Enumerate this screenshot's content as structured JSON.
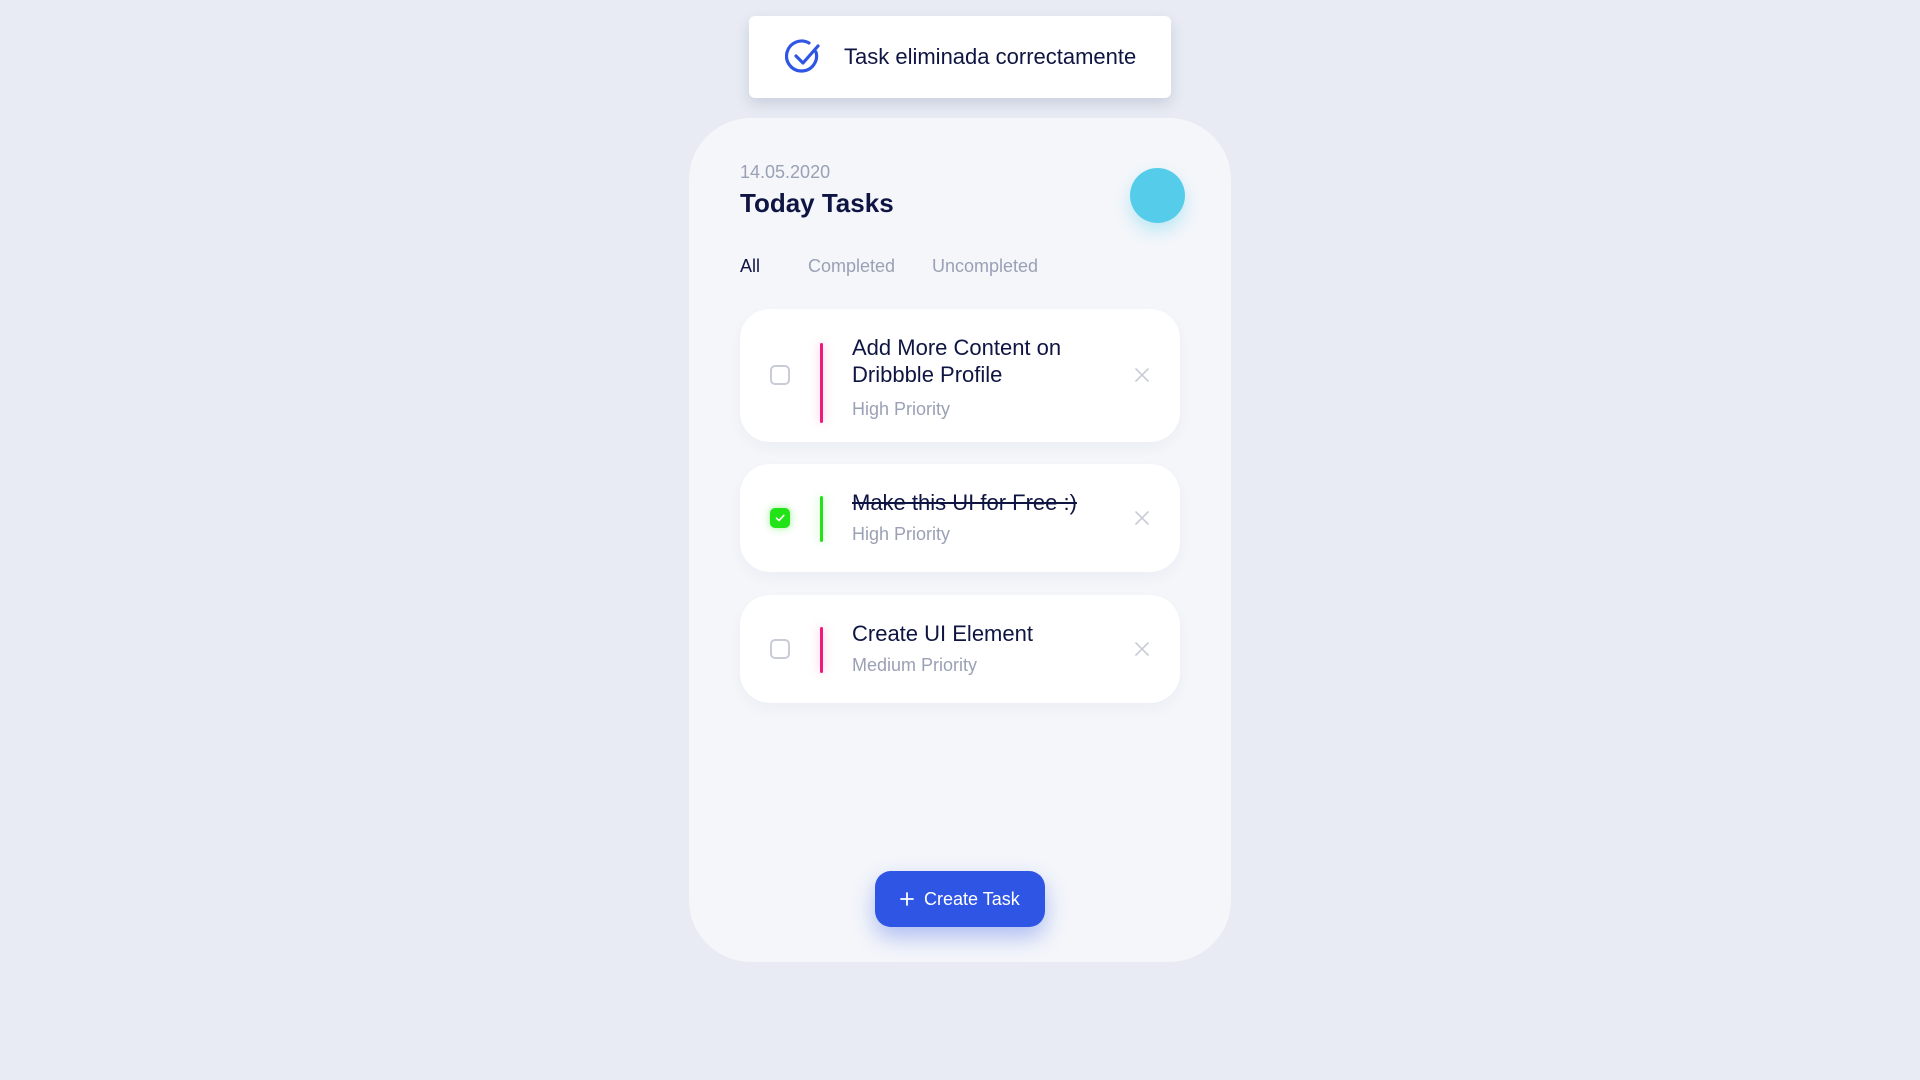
{
  "toast": {
    "message": "Task eliminada correctamente",
    "icon": "check-circle-icon",
    "icon_color": "#2f55e4"
  },
  "header": {
    "date": "14.05.2020",
    "title": "Today Tasks",
    "avatar_color": "#55cdea"
  },
  "tabs": [
    {
      "label": "All",
      "active": true
    },
    {
      "label": "Completed",
      "active": false
    },
    {
      "label": "Uncompleted",
      "active": false
    }
  ],
  "tasks": [
    {
      "title": "Add More Content on Dribbble Profile",
      "priority": "High Priority",
      "completed": false,
      "bar_color": "#f0197b"
    },
    {
      "title": "Make this UI for Free :)",
      "priority": "High Priority",
      "completed": true,
      "bar_color": "#22e317"
    },
    {
      "title": "Create UI Element",
      "priority": "Medium Priority",
      "completed": false,
      "bar_color": "#f0197b"
    }
  ],
  "create_button": {
    "label": "Create Task",
    "color": "#2f55e4"
  }
}
